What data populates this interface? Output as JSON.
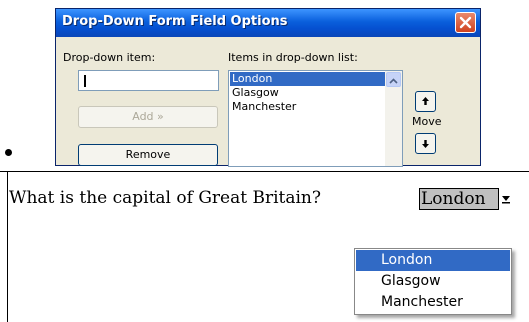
{
  "dialog": {
    "title": "Drop-Down Form Field Options",
    "dropdown_item_label": "Drop-down item:",
    "dropdown_item_value": "",
    "items_label": "Items in drop-down list:",
    "items": [
      "London",
      "Glasgow",
      "Manchester"
    ],
    "selected_index": 0,
    "add_label": "Add »",
    "remove_label": "Remove",
    "move_label": "Move"
  },
  "document": {
    "question": "What is the capital of Great Britain?",
    "field_value": "London",
    "dropdown_options": [
      "London",
      "Glasgow",
      "Manchester"
    ],
    "dropdown_selected_index": 0
  },
  "icons": {
    "close": "close-icon",
    "arrow_up": "arrow-up-icon",
    "arrow_down": "arrow-down-icon",
    "dropdown": "dropdown-arrow-icon",
    "bullet": "bullet-icon"
  },
  "colors": {
    "titlebar": "#0a5fdc",
    "selection": "#316ac5",
    "field_shading": "#c0c0c0",
    "close_button": "#d0421f"
  }
}
